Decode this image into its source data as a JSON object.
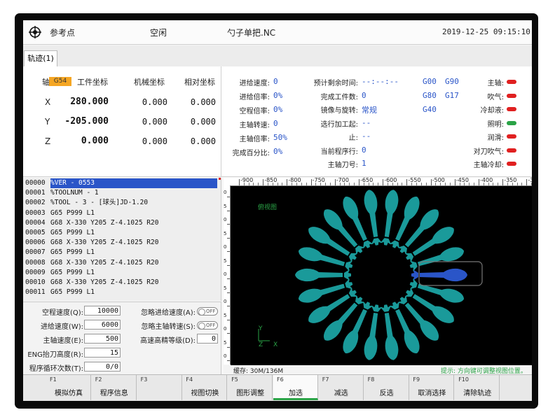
{
  "header": {
    "ref_label": "参考点",
    "state": "空闲",
    "file": "勺子单把.NC",
    "datetime": "2019-12-25 09:15:10"
  },
  "tabs": [
    "轨迹(1)"
  ],
  "coords": {
    "axis_label": "轴",
    "wcs_badge": "G54",
    "col_work": "工件坐标",
    "col_machine": "机械坐标",
    "col_relative": "相对坐标",
    "rows": [
      {
        "axis": "X",
        "work": "280.000",
        "machine": "0.000",
        "relative": "0.000"
      },
      {
        "axis": "Y",
        "work": "-205.000",
        "machine": "0.000",
        "relative": "0.000"
      },
      {
        "axis": "Z",
        "work": "0.000",
        "machine": "0.000",
        "relative": "0.000"
      }
    ]
  },
  "status": {
    "col1": [
      {
        "label": "进给速度:",
        "value": "0"
      },
      {
        "label": "进给倍率:",
        "value": "0%"
      },
      {
        "label": "空程倍率:",
        "value": "0%"
      },
      {
        "label": "主轴转速:",
        "value": "0"
      },
      {
        "label": "主轴倍率:",
        "value": "50%"
      },
      {
        "label": "完成百分比:",
        "value": "0%"
      }
    ],
    "col2": [
      {
        "label": "预计剩余时间:",
        "value": "--:--:--"
      },
      {
        "label": "完成工件数:",
        "value": "0"
      },
      {
        "label": "镜像与旋转:",
        "value": "常规"
      },
      {
        "label": "选行加工起:",
        "value": "--"
      },
      {
        "label": "止:",
        "value": "--"
      },
      {
        "label": "当前程序行:",
        "value": "0"
      },
      {
        "label": "主轴刀号:",
        "value": "1"
      }
    ],
    "gcodes": [
      [
        "G00",
        "G90"
      ],
      [
        "G80",
        "G17"
      ],
      [
        "G40",
        ""
      ]
    ],
    "indicators": [
      {
        "label": "主轴:",
        "color": "#e02020"
      },
      {
        "label": "吹气:",
        "color": "#e02020"
      },
      {
        "label": "冷却液:",
        "color": "#e02020"
      },
      {
        "label": "照明:",
        "color": "#2aa346"
      },
      {
        "label": "润滑:",
        "color": "#e02020"
      },
      {
        "label": "对刀吹气:",
        "color": "#e02020"
      },
      {
        "label": "主轴冷却:",
        "color": "#e02020"
      }
    ]
  },
  "program": [
    {
      "n": "00000",
      "code": "%VER - 0553"
    },
    {
      "n": "00001",
      "code": "%TOOLNUM - 1"
    },
    {
      "n": "00002",
      "code": "%TOOL - 3 - [球头]JD-1.20"
    },
    {
      "n": "00003",
      "code": "G65 P999 L1"
    },
    {
      "n": "00004",
      "code": "G68 X-330 Y205 Z-4.1025 R20"
    },
    {
      "n": "00005",
      "code": "G65 P999 L1"
    },
    {
      "n": "00006",
      "code": "G68 X-330 Y205 Z-4.1025 R20"
    },
    {
      "n": "00007",
      "code": "G65 P999 L1"
    },
    {
      "n": "00008",
      "code": "G68 X-330 Y205 Z-4.1025 R20"
    },
    {
      "n": "00009",
      "code": "G65 P999 L1"
    },
    {
      "n": "00010",
      "code": "G68 X-330 Y205 Z-4.1025 R20"
    },
    {
      "n": "00011",
      "code": "G65 P999 L1"
    }
  ],
  "settings": {
    "idle_speed_label": "空程速度(Q):",
    "idle_speed": "10000",
    "feed_speed_label": "进给速度(W):",
    "feed_speed": "6000",
    "spindle_speed_label": "主轴速度(E):",
    "spindle_speed": "500",
    "eng_lift_label": "ENG抬刀高度(R):",
    "eng_lift": "15",
    "loop_label": "程序循环次数(T):",
    "loop": "0/0",
    "ignore_feed_label": "忽略进给速度(A):",
    "ignore_spindle_label": "忽略主轴转速(S):",
    "precision_label": "高速高精等级(D):",
    "precision": "0",
    "toggle_off": "OFF"
  },
  "viewport": {
    "view_name": "俯视图",
    "ruler_ticks": [
      "-900",
      "-850",
      "-800",
      "-750",
      "-700",
      "-650",
      "-600",
      "-550",
      "-500",
      "-450",
      "-400",
      "-350",
      "-3"
    ],
    "vruler_ticks": [
      "0",
      "5",
      "0",
      "5",
      "0",
      "5",
      "0",
      "5",
      "0",
      "5",
      "0",
      "5",
      "0"
    ],
    "axis_y": "Y",
    "axis_z": "Z",
    "axis_x": "X",
    "buffer": "缓存: 30M/136M",
    "hint": "提示: 方向键可调整视图位置。",
    "spoon_count": 22,
    "spoon_color": "#1a9a9a",
    "highlight_color": "#2a55c8"
  },
  "softkeys": [
    {
      "fn": "F1",
      "label": "模拟仿真"
    },
    {
      "fn": "F2",
      "label": "程序信息"
    },
    {
      "fn": "F3",
      "label": ""
    },
    {
      "fn": "F4",
      "label": "视图切换"
    },
    {
      "fn": "F5",
      "label": "图形调整"
    },
    {
      "fn": "F6",
      "label": "加选",
      "active": true
    },
    {
      "fn": "F7",
      "label": "减选"
    },
    {
      "fn": "F8",
      "label": "反选"
    },
    {
      "fn": "F9",
      "label": "取消选择"
    },
    {
      "fn": "F10",
      "label": "清除轨迹"
    }
  ]
}
